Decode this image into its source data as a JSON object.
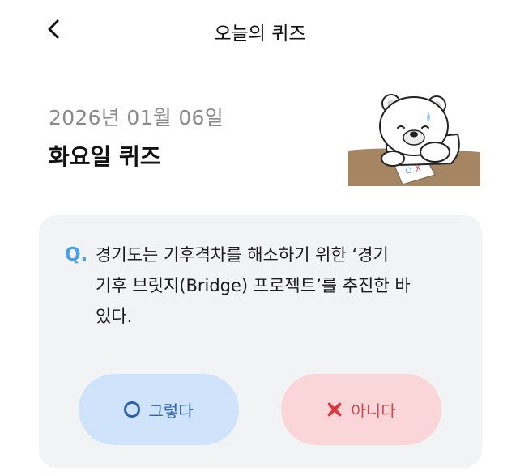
{
  "header": {
    "title": "오늘의 퀴즈",
    "back_icon": "chevron-left-icon"
  },
  "quiz": {
    "date": "2026년 01월 06일",
    "title": "화요일 퀴즈",
    "question_marker": "Q.",
    "question_lines": [
      "경기도는 기후격차를 해소하기 위한 ‘경기",
      "기후 브릿지(Bridge) 프로젝트’를 추진한 바",
      "있다."
    ],
    "illustration": "bear-mascot-with-ox-quiz-paper"
  },
  "answers": {
    "yes": {
      "label": "그렇다",
      "icon": "circle-o-icon",
      "color": "#2f63b0",
      "bg": "#cfe4fb"
    },
    "no": {
      "label": "아니다",
      "icon": "x-mark-icon",
      "color": "#c84a52",
      "bg": "#fbd6d8"
    }
  }
}
